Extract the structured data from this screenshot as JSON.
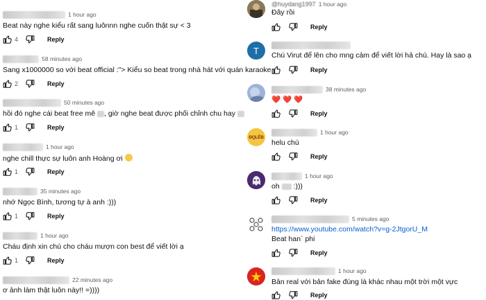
{
  "left_comments": [
    {
      "time": "1 hour ago",
      "text": "Beat này nghe kiểu rất sang luônnn nghe cuốn thật sự < 3",
      "likes": "4",
      "reply": "Reply"
    },
    {
      "time": "58 minutes ago",
      "text": "Sang x1000000 so với beat official :\"> Kiểu so beat trong nhà hát với quán karaoke",
      "likes": "2",
      "reply": "Reply"
    },
    {
      "time": "50 minutes ago",
      "text_a": "hồi đó nghe cái beat free mê ",
      "text_b": ", giờ nghe beat được phối chỉnh chu hay ",
      "likes": "1",
      "reply": "Reply"
    },
    {
      "time": "1 hour ago",
      "text": "nghe chill thực sự luôn anh Hoàng ơi",
      "likes": "1",
      "reply": "Reply"
    },
    {
      "time": "35 minutes ago",
      "text": "nhớ Ngọc Bình, tương tự à anh :)))",
      "likes": "1",
      "reply": "Reply"
    },
    {
      "time": "1 hour ago",
      "text": "Cháu định xin chú cho cháu mượn con best để viết lời ạ",
      "likes": "1",
      "reply": "Reply"
    },
    {
      "time": "22 minutes ago",
      "text": "ơ ảnh làm thật luôn này!! =))))",
      "likes": "",
      "reply": ""
    }
  ],
  "right_comments": [
    {
      "handle": "@huydang1997",
      "time": "1 hour ago",
      "text": "Đây rồi",
      "reply": "Reply",
      "avatar": "photo"
    },
    {
      "handle": "",
      "time": "",
      "text": "Chú Virut để lên cho mng cảm để viết lời hả chú. Hay là sao ạ",
      "reply": "Reply",
      "avatar": "letter",
      "avatar_letter": "T"
    },
    {
      "handle": "",
      "time": "38 minutes ago",
      "text": "❤️ ❤️ ❤️",
      "reply": "Reply",
      "avatar": "photo2"
    },
    {
      "handle": "",
      "time": "1 hour ago",
      "text": "helu chú",
      "reply": "Reply",
      "avatar": "logo",
      "avatar_logo_text": "ĐQLÊB"
    },
    {
      "handle": "",
      "time": "1 hour ago",
      "text_a": "oh ",
      "text_b": " :)))",
      "reply": "Reply",
      "avatar": "ghost"
    },
    {
      "handle": "",
      "time": "5 minutes ago",
      "link": "https://www.youtube.com/watch?v=g-2JtgorU_M",
      "text": "Beat han` phi",
      "reply": "Reply",
      "avatar": "pattern"
    },
    {
      "handle": "",
      "time": "1 hour ago",
      "text": "Bản real với bản fake đúng là khác nhau một trời một vực",
      "reply": "Reply",
      "avatar": "flag"
    }
  ],
  "icons": {
    "like": "thumbs-up-icon",
    "dislike": "thumbs-down-icon"
  },
  "colors": {
    "link": "#065fd4",
    "text": "#0f0f0f",
    "meta": "#606060",
    "letter_avatar": "#1e6fa8",
    "flag_red": "#da251d",
    "flag_star": "#ffcd00"
  }
}
